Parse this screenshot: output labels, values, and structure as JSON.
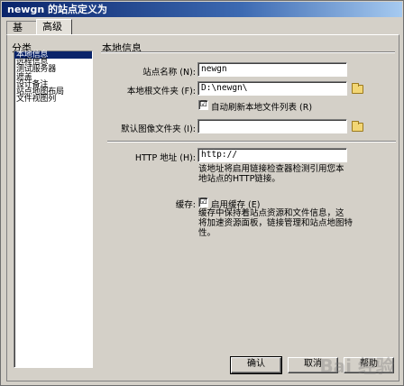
{
  "window": {
    "title": "newgn 的站点定义为"
  },
  "tabs": [
    {
      "label": "基本"
    },
    {
      "label": "高级"
    }
  ],
  "category": {
    "heading": "分类",
    "items": [
      {
        "label": "本地信息"
      },
      {
        "label": "远程信息"
      },
      {
        "label": "测试服务器"
      },
      {
        "label": "遮盖"
      },
      {
        "label": "设计备注"
      },
      {
        "label": "站点地图布局"
      },
      {
        "label": "文件视图列"
      }
    ]
  },
  "local_info": {
    "heading": "本地信息",
    "site_name": {
      "label": "站点名称 (N):",
      "value": "newgn"
    },
    "root_folder": {
      "label": "本地根文件夹 (F):",
      "value": "D:\\newgn\\"
    },
    "auto_refresh": {
      "label": "自动刷新本地文件列表 (R)",
      "checked": "☑"
    },
    "default_images": {
      "label": "默认图像文件夹 (I):",
      "value": ""
    },
    "http": {
      "label": "HTTP 地址 (H):",
      "value": "http://",
      "hint_line1": "该地址将启用链接检查器检测引用您本",
      "hint_line2": "地站点的HTTP链接。"
    },
    "cache": {
      "label": "缓存:",
      "checkbox_label": "启用缓存 (E)",
      "hint_line1": "缓存中保持着站点资源和文件信息，这",
      "hint_line2": "将加速资源面板，链接管理和站点地图特",
      "hint_line3": "性。"
    }
  },
  "buttons": {
    "ok": "确认",
    "cancel": "取消",
    "help": "帮助"
  },
  "watermark": "Bai 经验"
}
